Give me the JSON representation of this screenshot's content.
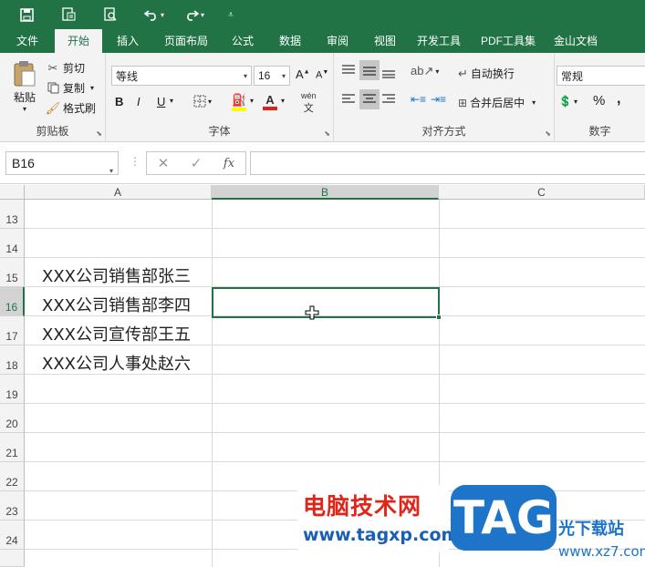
{
  "qat": {
    "save_icon": "save-icon",
    "print_preview_icon": "print-preview-icon",
    "preview_icon": "zoom-preview-icon",
    "undo_icon": "undo-icon",
    "redo_icon": "redo-icon",
    "customize_icon": "customize-qat-icon"
  },
  "tabs": [
    {
      "label": "文件"
    },
    {
      "label": "开始"
    },
    {
      "label": "插入"
    },
    {
      "label": "页面布局"
    },
    {
      "label": "公式"
    },
    {
      "label": "数据"
    },
    {
      "label": "审阅"
    },
    {
      "label": "视图"
    },
    {
      "label": "开发工具"
    },
    {
      "label": "PDF工具集"
    },
    {
      "label": "金山文档"
    }
  ],
  "ribbon": {
    "clipboard": {
      "label": "剪贴板",
      "paste": "粘贴",
      "cut": "剪切",
      "copy": "复制",
      "format_painter": "格式刷"
    },
    "font": {
      "label": "字体",
      "font_name": "等线",
      "font_size": "16",
      "bold": "B",
      "italic": "I",
      "underline": "U",
      "phonetic": "wén"
    },
    "alignment": {
      "label": "对齐方式",
      "wrap_text": "自动换行",
      "merge_center": "合并后居中"
    },
    "number": {
      "label": "数字",
      "format": "常规",
      "percent": "%",
      "comma": ","
    }
  },
  "formula_bar": {
    "name_box": "B16",
    "fx": "fx",
    "value": ""
  },
  "grid": {
    "columns": [
      "A",
      "B",
      "C"
    ],
    "selected_column": "B",
    "rows": [
      {
        "num": "13",
        "a": ""
      },
      {
        "num": "14",
        "a": ""
      },
      {
        "num": "15",
        "a": "XXX公司销售部张三"
      },
      {
        "num": "16",
        "a": "XXX公司销售部李四"
      },
      {
        "num": "17",
        "a": "XXX公司宣传部王五"
      },
      {
        "num": "18",
        "a": "XXX公司人事处赵六"
      },
      {
        "num": "19",
        "a": ""
      },
      {
        "num": "20",
        "a": ""
      },
      {
        "num": "21",
        "a": ""
      },
      {
        "num": "22",
        "a": ""
      },
      {
        "num": "23",
        "a": ""
      },
      {
        "num": "24",
        "a": ""
      }
    ],
    "selected_row": "16"
  },
  "watermark": {
    "title": "电脑技术网",
    "url": "www.tagxp.com",
    "tag": "TAG",
    "cn2": "光下载站",
    "url2": "www.xz7.com"
  },
  "colors": {
    "accent": "#217346",
    "watermark_red": "#e0251b",
    "watermark_blue": "#1d74c9"
  }
}
